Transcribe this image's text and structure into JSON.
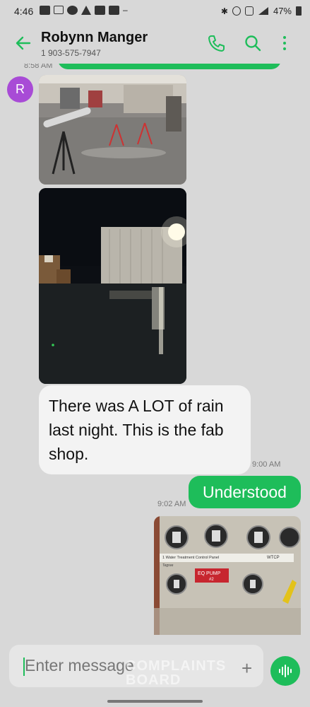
{
  "status_bar": {
    "time": "4:46",
    "battery": "47%"
  },
  "header": {
    "contact_name": "Robynn Manger",
    "contact_phone": "1 903-575-7947"
  },
  "chat": {
    "previous_time": "8:58 AM",
    "avatar_initial": "R",
    "incoming_text": "There was A LOT of rain last night. This is the fab shop.",
    "incoming_time": "9:00 AM",
    "outgoing_text": "Understood",
    "outgoing_time": "9:02 AM",
    "panel_title": "1 Water Treatment Control Panel",
    "panel_brand": "Tegree",
    "panel_code": "WTCP",
    "panel_pump_label": "EQ PUMP",
    "panel_pump_number": "#2"
  },
  "composer": {
    "placeholder": "Enter message"
  },
  "watermark": {
    "line1": "COMPLAINTS",
    "line2": "BOARD"
  },
  "colors": {
    "accent": "#1ebd5a",
    "avatar": "#a84bd6",
    "background": "#d8d8d8"
  }
}
